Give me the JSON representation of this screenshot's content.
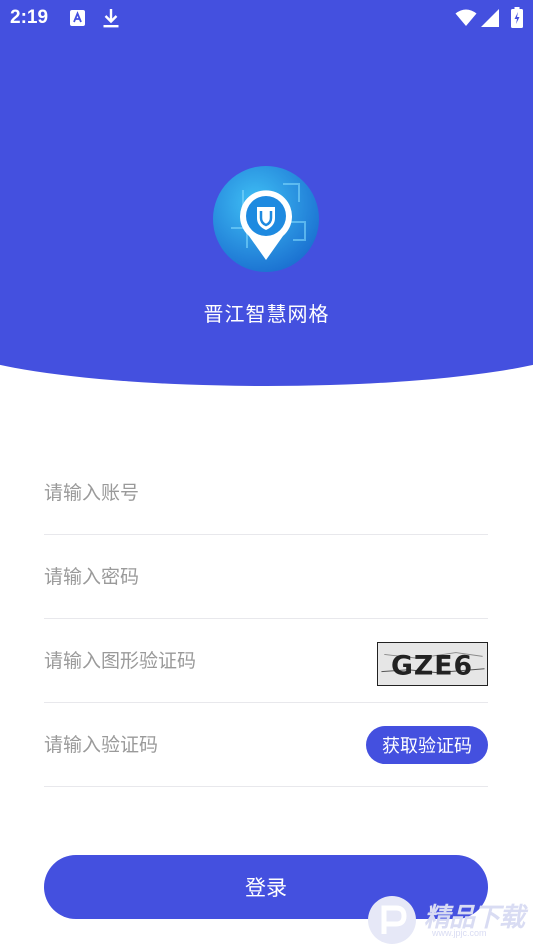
{
  "status_bar": {
    "time": "2:19",
    "icons": [
      "a-icon",
      "download-icon",
      "wifi-icon",
      "signal-icon",
      "battery-icon"
    ]
  },
  "app": {
    "title": "晋江智慧网格",
    "logo_icon": "location-shield-logo"
  },
  "form": {
    "account_placeholder": "请输入账号",
    "password_placeholder": "请输入密码",
    "captcha_placeholder": "请输入图形验证码",
    "captcha_text": "GZE6",
    "sms_placeholder": "请输入验证码",
    "get_code_label": "获取验证码",
    "login_label": "登录"
  },
  "watermark": {
    "text": "精品下载",
    "url": "www.jpjc.com"
  },
  "colors": {
    "primary": "#4450df",
    "background": "#ffffff",
    "placeholder": "#9a9a9a",
    "divider": "#e8e8ec"
  }
}
